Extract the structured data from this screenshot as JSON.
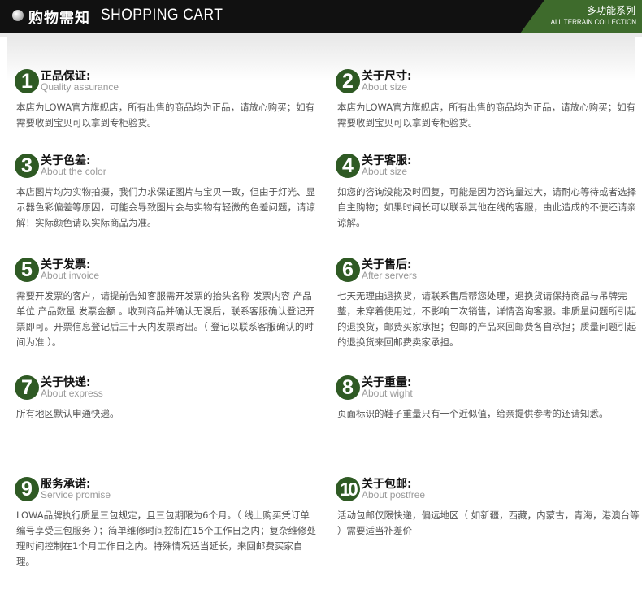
{
  "header": {
    "title_cn": "购物需知",
    "title_en": "SHOPPING CART",
    "tag_cn": "多功能系列",
    "tag_en": "ALL TERRAIN COLLECTION"
  },
  "colors": {
    "accent": "#2f5a24",
    "header_bg": "#111111",
    "tag_bg": "#3e6b2c"
  },
  "items": [
    {
      "num": "1",
      "title": "正品保证:",
      "subtitle": "Quality assurance",
      "body": "本店为LOWA官方旗舰店，所有出售的商品均为正品，请放心购买；如有需要收到宝贝可以拿到专柜验货。"
    },
    {
      "num": "2",
      "title": "关于尺寸:",
      "subtitle": "About size",
      "body": "本店为LOWA官方旗舰店，所有出售的商品均为正品，请放心购买；如有需要收到宝贝可以拿到专柜验货。"
    },
    {
      "num": "3",
      "title": "关于色差:",
      "subtitle": "About the color",
      "body": "本店图片均为实物拍摄，我们力求保证图片与宝贝一致，但由于灯光、显示器色彩偏差等原因，可能会导致图片会与实物有轻微的色差问题，请谅解！实际颜色请以实际商品为准。"
    },
    {
      "num": "4",
      "title": "关于客服:",
      "subtitle": "About size",
      "body": "如您的咨询没能及时回复，可能是因为咨询量过大，请耐心等待或者选择自主购物；如果时间长可以联系其他在线的客服，由此造成的不便还请亲谅解。"
    },
    {
      "num": "5",
      "title": "关于发票:",
      "subtitle": "About invoice",
      "body": "需要开发票的客户，请提前告知客服需开发票的抬头名称 发票内容 产品单位 产品数量 发票金额 。收到商品并确认无误后，联系客服确认登记开票即可。开票信息登记后三十天内发票寄出。（ 登记以联系客服确认的时间为准 ）。"
    },
    {
      "num": "6",
      "title": "关于售后:",
      "subtitle": "After servers",
      "body": "七天无理由退换货，请联系售后帮您处理，退换货请保持商品与吊牌完整，未穿着使用过，不影响二次销售，详情咨询客服。非质量问题所引起的退换货，邮费买家承担；包邮的产品来回邮费各自承担；质量问题引起的退换货来回邮费卖家承担。"
    },
    {
      "num": "7",
      "title": "关于快递:",
      "subtitle": "About express",
      "body": "所有地区默认申通快递。"
    },
    {
      "num": "8",
      "title": "关于重量:",
      "subtitle": "About wight",
      "body": "页面标识的鞋子重量只有一个近似值，给亲提供参考的还请知悉。"
    },
    {
      "num": "9",
      "title": "服务承诺:",
      "subtitle": "Service promise",
      "body": " LOWA品牌执行质量三包规定，且三包期限为6个月。（ 线上购买凭订单编号享受三包服务 ）；简单维修时间控制在15个工作日之内；复杂维修处理时间控制在1个月工作日之内。特殊情况适当延长，来回邮费买家自理。"
    },
    {
      "num": "10",
      "title": "关于包邮:",
      "subtitle": "About postfree",
      "body": "活动包邮仅限快递，偏远地区（ 如新疆，西藏，内蒙古，青海，港澳台等 ）需要适当补差价"
    }
  ]
}
